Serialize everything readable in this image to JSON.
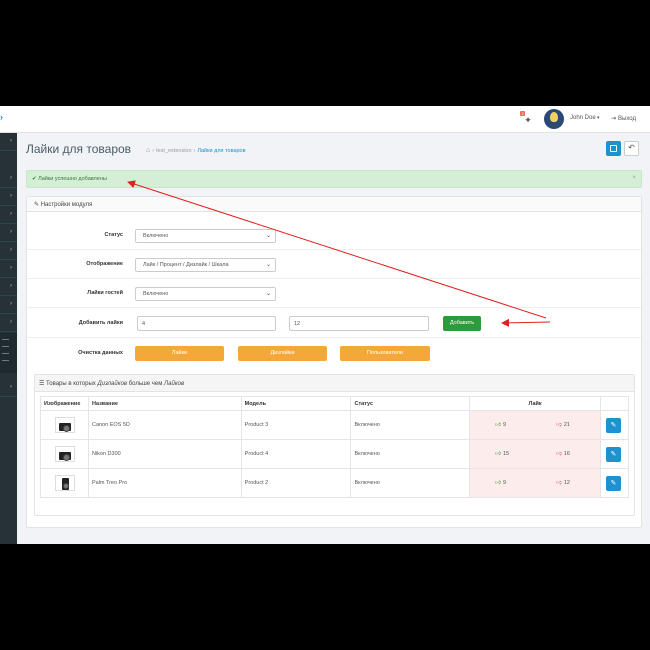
{
  "header": {
    "notification_count": "2",
    "user_name": "John Doe",
    "logout_label": "Выход"
  },
  "page": {
    "title": "Лайки для товаров",
    "breadcrumb": [
      "test_extension",
      "Лайки для товаров"
    ]
  },
  "alert": {
    "text": "Лайки успешно добавлены",
    "close": "×"
  },
  "settings": {
    "title": "Настройки модуля",
    "status_label": "Статус",
    "status_value": "Включено",
    "display_label": "Отображение",
    "display_value": "Лайк / Процент / Дизлайк / Шкала",
    "guest_label": "Лайки гостей",
    "guest_value": "Включено",
    "add_label": "Добавить лайки",
    "add_likes_value": "4",
    "add_dislikes_value": "12",
    "add_button": "Добавить",
    "clear_label": "Очистка данных",
    "clear_likes": "Лайки",
    "clear_dislikes": "Дизлайки",
    "clear_users": "Пользователи"
  },
  "products_panel": {
    "title_prefix": "Товары в которых ",
    "title_em1": "Дизлайков",
    "title_mid": " больше чем ",
    "title_em2": "Лайков",
    "columns": [
      "Изображение",
      "Название",
      "Модель",
      "Статус",
      "Лайк",
      ""
    ],
    "rows": [
      {
        "name": "Canon EOS 5D",
        "model": "Product 3",
        "status": "Включено",
        "likes": "9",
        "dislikes": "21"
      },
      {
        "name": "Nikon D300",
        "model": "Product 4",
        "status": "Включено",
        "likes": "15",
        "dislikes": "16"
      },
      {
        "name": "Palm Treo Pro",
        "model": "Product 2",
        "status": "Включено",
        "likes": "9",
        "dislikes": "12"
      }
    ]
  },
  "colors": {
    "primary": "#1e91cf",
    "success": "#2e9a3a",
    "warning": "#f4a83a",
    "danger": "#d9534f",
    "alert_bg": "#d5efd6",
    "annotation_arrow": "#e02020"
  }
}
